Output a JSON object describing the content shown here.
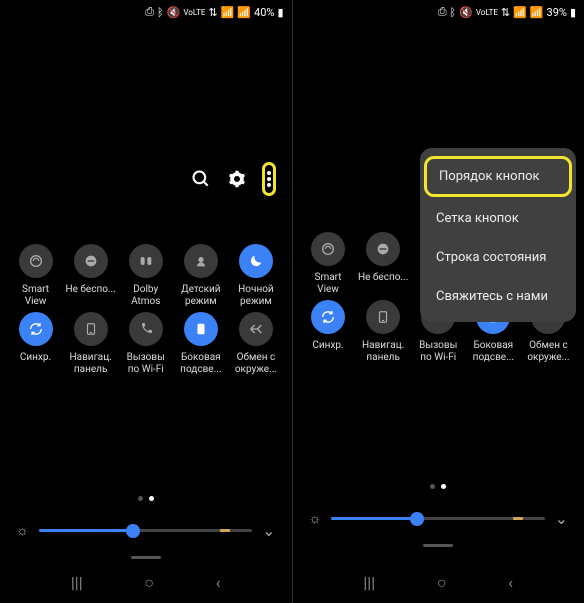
{
  "left": {
    "status": {
      "battery_pct": "40%"
    },
    "toolbar": {
      "search": "search",
      "settings": "settings",
      "more": "more"
    },
    "tiles_row1": [
      {
        "label": "Smart View",
        "icon": "cast",
        "active": false
      },
      {
        "label": "Не беспо...",
        "icon": "dnd",
        "active": false
      },
      {
        "label": "Dolby Atmos",
        "icon": "dolby",
        "active": false
      },
      {
        "label": "Детский режим",
        "icon": "kids",
        "active": false
      },
      {
        "label": "Ночной режим",
        "icon": "moon",
        "active": true
      }
    ],
    "tiles_row2": [
      {
        "label": "Синхр.",
        "icon": "sync",
        "active": true
      },
      {
        "label": "Навигац. панель",
        "icon": "nav",
        "active": false
      },
      {
        "label": "Вызовы по Wi-Fi",
        "icon": "wifi-call",
        "active": false
      },
      {
        "label": "Боковая подсве...",
        "icon": "edge",
        "active": true
      },
      {
        "label": "Обмен с окруже...",
        "icon": "share",
        "active": false
      }
    ],
    "brightness_pct": 44
  },
  "right": {
    "status": {
      "battery_pct": "39%"
    },
    "tiles_row1": [
      {
        "label": "Smart View",
        "icon": "cast",
        "active": false
      },
      {
        "label": "Не беспо...",
        "icon": "dnd",
        "active": false
      }
    ],
    "tiles_row2": [
      {
        "label": "Синхр.",
        "icon": "sync",
        "active": true
      },
      {
        "label": "Навигац. панель",
        "icon": "nav",
        "active": false
      },
      {
        "label": "Вызовы по Wi-Fi",
        "icon": "wifi-call",
        "active": false
      },
      {
        "label": "Боковая подсве...",
        "icon": "edge",
        "active": true
      },
      {
        "label": "Обмен с окруже...",
        "icon": "share",
        "active": false
      }
    ],
    "menu": [
      "Порядок кнопок",
      "Сетка кнопок",
      "Строка состояния",
      "Свяжитесь с нами"
    ],
    "brightness_pct": 40
  }
}
